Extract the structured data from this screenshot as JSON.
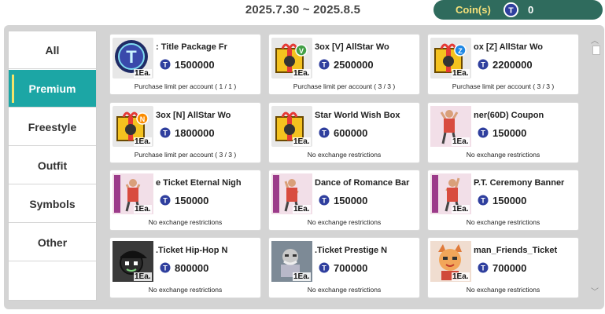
{
  "header": {
    "date_range": "2025.7.30 ~ 2025.8.5",
    "coin_label": "Coin(s)",
    "coin_value": "0",
    "coin_icon": "t-coin-icon"
  },
  "sidebar": {
    "items": [
      {
        "label": "All",
        "active": false
      },
      {
        "label": "Premium",
        "active": true
      },
      {
        "label": "Freestyle",
        "active": false
      },
      {
        "label": "Outfit",
        "active": false
      },
      {
        "label": "Symbols",
        "active": false
      },
      {
        "label": "Other",
        "active": false
      }
    ]
  },
  "colors": {
    "accent": "#1ca6a5",
    "active_marker": "#f3e36a",
    "coin_pill": "#2f6b5d",
    "coin_text": "#f4e07a"
  },
  "items": [
    {
      "name": ": Title Package      Fr",
      "price": "1500000",
      "quantity": "1Ea.",
      "limit": "Purchase limit per account ( 1 / 1 )",
      "icon": "t-title-token-icon"
    },
    {
      "name": "3ox      [V] AllStar Wo",
      "price": "2500000",
      "quantity": "1Ea.",
      "limit": "Purchase limit per account ( 3 / 3 )",
      "icon": "gift-box-v-icon"
    },
    {
      "name": "ox      [Z] AllStar Wo",
      "price": "2200000",
      "quantity": "1Ea.",
      "limit": "Purchase limit per account ( 3 / 3 )",
      "icon": "gift-box-z-icon"
    },
    {
      "name": "3ox      [N] AllStar Wo",
      "price": "1800000",
      "quantity": "1Ea.",
      "limit": "Purchase limit per account ( 3 / 3 )",
      "icon": "gift-box-n-icon"
    },
    {
      "name": "Star World Wish Box",
      "price": "600000",
      "quantity": "1Ea.",
      "limit": "No exchange restrictions",
      "icon": "gift-box-icon"
    },
    {
      "name": "ner(60D) Coupon",
      "price": "150000",
      "quantity": "1Ea.",
      "limit": "No exchange restrictions",
      "icon": "dance-pose-icon"
    },
    {
      "name": "e Ticket      Eternal Nigh",
      "price": "150000",
      "quantity": "1Ea.",
      "limit": "No exchange restrictions",
      "icon": "dance-pose-icon"
    },
    {
      "name": "Dance of Romance Bar",
      "price": "150000",
      "quantity": "1Ea.",
      "limit": "No exchange restrictions",
      "icon": "dance-pose-icon"
    },
    {
      "name": "P.T. Ceremony Banner",
      "price": "150000",
      "quantity": "1Ea.",
      "limit": "No exchange restrictions",
      "icon": "dance-pose-icon"
    },
    {
      "name": ".Ticket      Hip-Hop N",
      "price": "800000",
      "quantity": "1Ea.",
      "limit": "No exchange restrictions",
      "icon": "cap-character-icon"
    },
    {
      "name": ".Ticket      Prestige N",
      "price": "700000",
      "quantity": "1Ea.",
      "limit": "No exchange restrictions",
      "icon": "elder-character-icon"
    },
    {
      "name": "man_Friends_Ticket",
      "price": "700000",
      "quantity": "1Ea.",
      "limit": "No exchange restrictions",
      "icon": "cat-character-icon"
    }
  ]
}
